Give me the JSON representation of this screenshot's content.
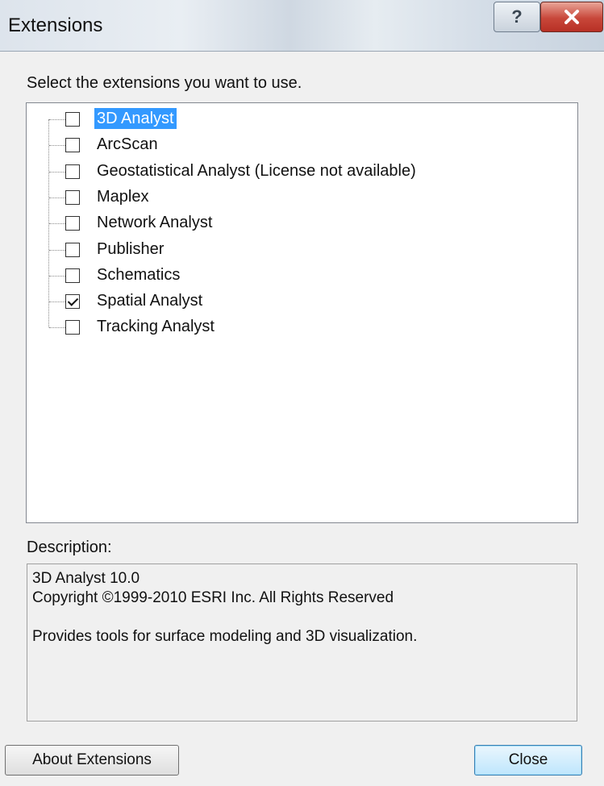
{
  "window": {
    "title": "Extensions",
    "help_glyph": "?",
    "close_icon": "close-x-icon",
    "close_color": "#c8473a"
  },
  "instruction": "Select the extensions you want to use.",
  "extensions": [
    {
      "label": "3D Analyst",
      "checked": false,
      "selected": true
    },
    {
      "label": "ArcScan",
      "checked": false,
      "selected": false
    },
    {
      "label": "Geostatistical Analyst (License not available)",
      "checked": false,
      "selected": false
    },
    {
      "label": "Maplex",
      "checked": false,
      "selected": false
    },
    {
      "label": "Network Analyst",
      "checked": false,
      "selected": false
    },
    {
      "label": "Publisher",
      "checked": false,
      "selected": false
    },
    {
      "label": "Schematics",
      "checked": false,
      "selected": false
    },
    {
      "label": "Spatial Analyst",
      "checked": true,
      "selected": false
    },
    {
      "label": "Tracking Analyst",
      "checked": false,
      "selected": false
    }
  ],
  "selection_color": "#3399ff",
  "description": {
    "label": "Description:",
    "line1": "3D Analyst 10.0",
    "line2": "Copyright ©1999-2010 ESRI Inc. All Rights Reserved",
    "line3": "Provides tools for surface modeling and 3D visualization."
  },
  "buttons": {
    "about": "About Extensions",
    "close": "Close"
  }
}
